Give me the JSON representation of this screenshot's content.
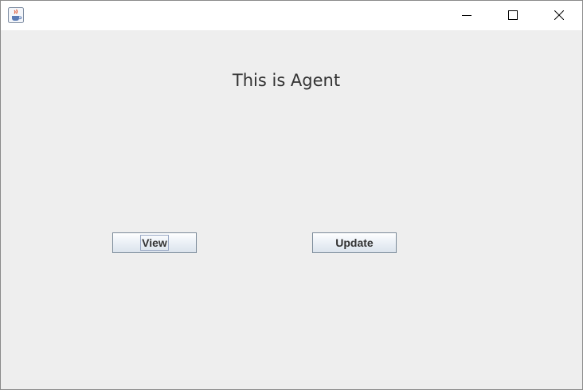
{
  "window": {
    "icon": "java-cup-icon",
    "controls": {
      "minimize": "minimize-icon",
      "maximize": "maximize-icon",
      "close": "close-icon"
    }
  },
  "main": {
    "heading": "This is Agent",
    "view_label": "View",
    "update_label": "Update"
  },
  "colors": {
    "background": "#eeeeee",
    "button_border": "#7a8a99",
    "text": "#333333"
  }
}
